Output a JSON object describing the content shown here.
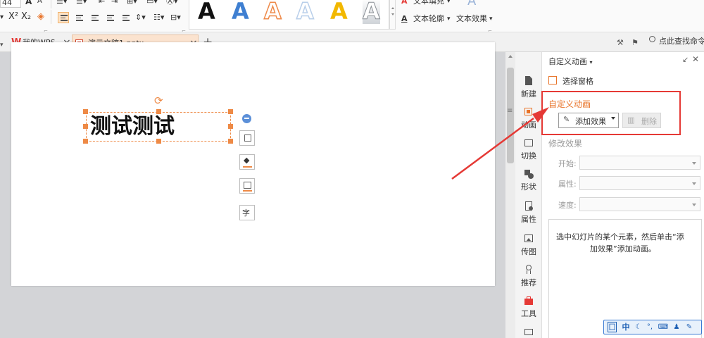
{
  "ribbon": {
    "font_size": "44",
    "bold_label": "A",
    "italic_label": "A",
    "superscript_label": "X²",
    "subscript_label": "X₂",
    "text_fill_label": "文本填充",
    "text_outline_label": "文本轮廓",
    "text_effect_label": "文本效果",
    "wordart_styles": [
      {
        "glyph": "A",
        "color": "#111111"
      },
      {
        "glyph": "A",
        "color": "#3f7fd1"
      },
      {
        "glyph": "A",
        "color": "#ee8a4a"
      },
      {
        "glyph": "A",
        "color": "#b9cfea"
      },
      {
        "glyph": "A",
        "color": "#f2b800"
      },
      {
        "glyph": "A",
        "color": "#8a8f95"
      }
    ],
    "search_label": "点此查找命令"
  },
  "tabs": {
    "wps_logo": "W",
    "home_label": "我的WPS",
    "doc_label": "演示文稿1.pptx",
    "close_glyph": "×",
    "new_tab_glyph": "+"
  },
  "slide": {
    "textbox_text": "测试测试"
  },
  "side_panel": {
    "items": [
      {
        "label": "新建",
        "icon": "new-doc-icon"
      },
      {
        "label": "动画",
        "icon": "animation-icon"
      },
      {
        "label": "切换",
        "icon": "transition-icon"
      },
      {
        "label": "形状",
        "icon": "shape-icon"
      },
      {
        "label": "属性",
        "icon": "property-icon"
      },
      {
        "label": "传图",
        "icon": "upload-image-icon"
      },
      {
        "label": "推荐",
        "icon": "recommend-icon"
      },
      {
        "label": "工具",
        "icon": "toolbox-icon"
      }
    ]
  },
  "task_pane": {
    "title": "自定义动画",
    "select_pane_label": "选择窗格",
    "section_title": "自定义动画",
    "add_effect_label": "添加效果",
    "delete_label": "删除",
    "modify_title": "修改效果",
    "start_label": "开始:",
    "property_label": "属性:",
    "speed_label": "速度:",
    "hint_line1": "选中幻灯片的某个元素，然后单击“添",
    "hint_line2": "加效果”添加动画。"
  },
  "ime_bar": {
    "mode_label": "中"
  },
  "colors": {
    "accent_orange": "#e8742a",
    "highlight_red": "#e53935",
    "tab_active_bg": "#fbe3cf"
  }
}
